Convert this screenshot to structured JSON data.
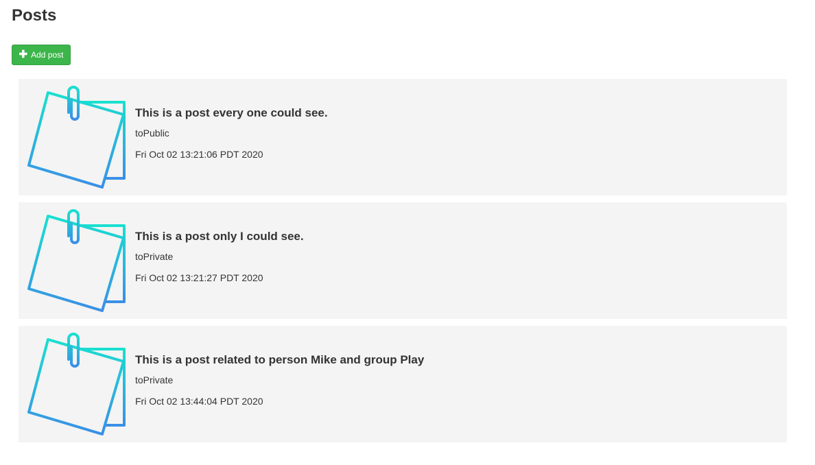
{
  "page": {
    "title": "Posts"
  },
  "toolbar": {
    "add_label": "Add post",
    "add_icon": "plus-icon",
    "add_color": "#3cb54a"
  },
  "posts": [
    {
      "title": "This is a post every one could see.",
      "visibility": "toPublic",
      "date": "Fri Oct 02 13:21:06 PDT 2020",
      "icon": "sticky-note-icon"
    },
    {
      "title": "This is a post only I could see.",
      "visibility": "toPrivate",
      "date": "Fri Oct 02 13:21:27 PDT 2020",
      "icon": "sticky-note-icon"
    },
    {
      "title": "This is a post related to person Mike and group Play",
      "visibility": "toPrivate",
      "date": "Fri Oct 02 13:44:04 PDT 2020",
      "icon": "sticky-note-icon"
    }
  ],
  "colors": {
    "card_background": "#f4f4f4",
    "icon_gradient_start": "#19e0cf",
    "icon_gradient_end": "#3a8fe6"
  }
}
